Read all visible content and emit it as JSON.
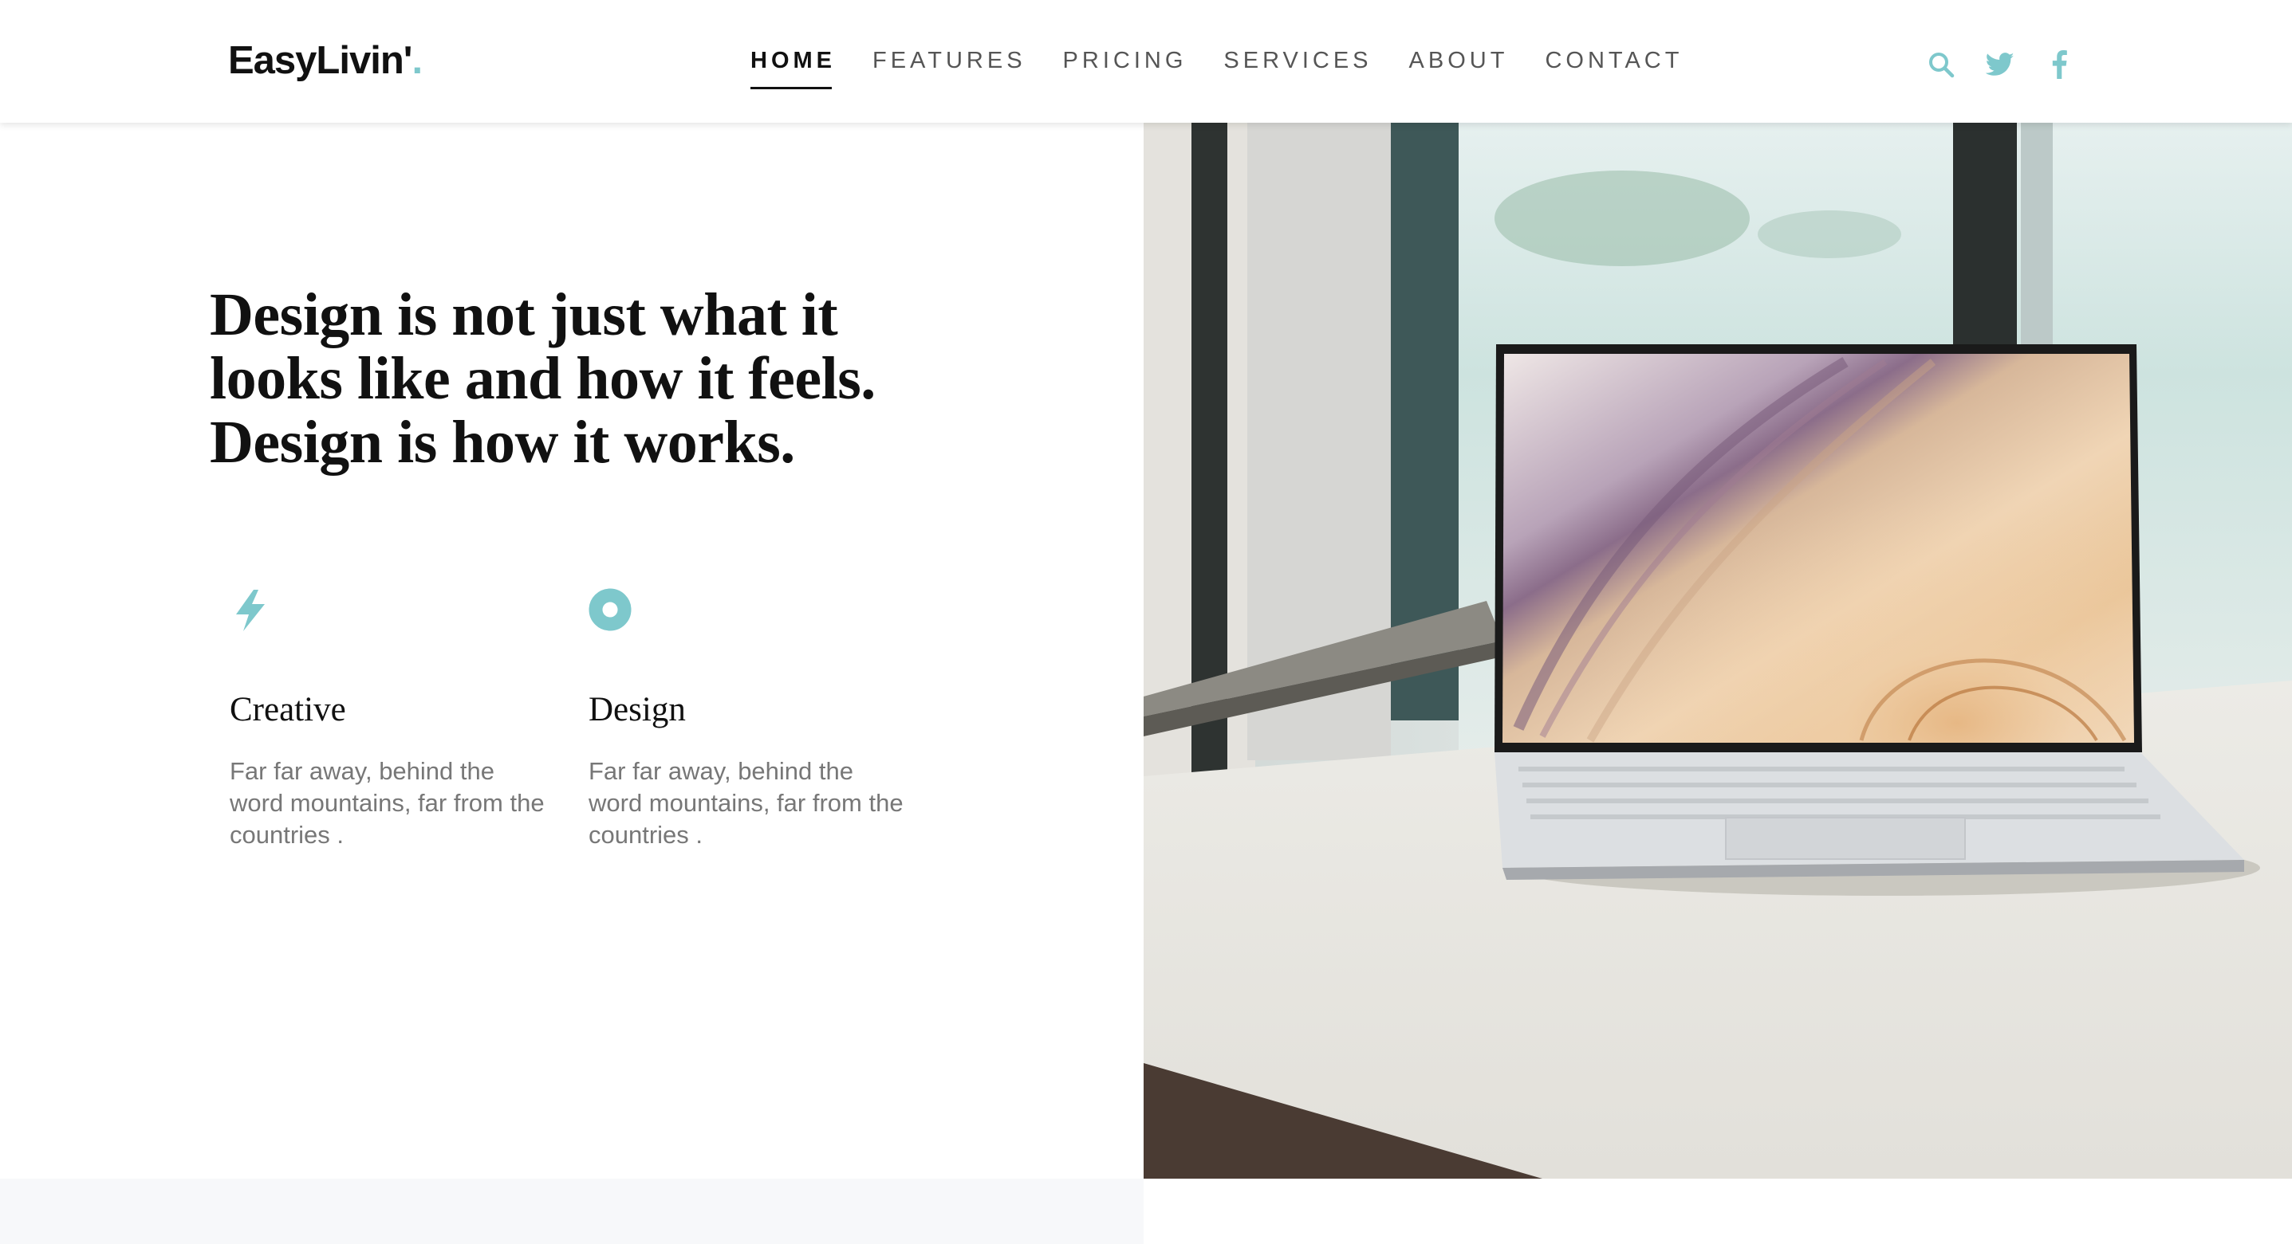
{
  "brand": {
    "name": "EasyLivin'",
    "dot": ".",
    "accent_color": "#7ec8cc"
  },
  "nav": {
    "items": [
      {
        "label": "HOME",
        "active": true
      },
      {
        "label": "FEATURES",
        "active": false
      },
      {
        "label": "PRICING",
        "active": false
      },
      {
        "label": "SERVICES",
        "active": false
      },
      {
        "label": "ABOUT",
        "active": false
      },
      {
        "label": "CONTACT",
        "active": false
      }
    ]
  },
  "social": {
    "icons": [
      "search-icon",
      "twitter-icon",
      "facebook-icon"
    ]
  },
  "hero": {
    "headline_lines": [
      "Design is not just what it",
      "looks like and how it feels.",
      "Design is how it works."
    ],
    "image_subject": "laptop-on-bench-photo"
  },
  "features": [
    {
      "icon": "lightning-icon",
      "title": "Creative",
      "description": "Far far away, behind the word mountains, far from the countries ."
    },
    {
      "icon": "ring-icon",
      "title": "Design",
      "description": "Far far away, behind the word mountains, far from the countries ."
    }
  ]
}
